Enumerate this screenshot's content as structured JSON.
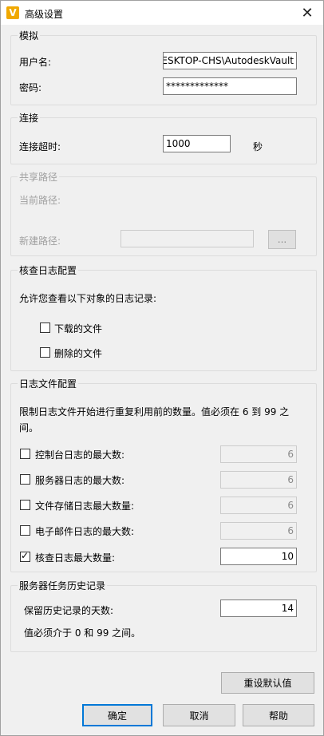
{
  "window": {
    "title": "高级设置",
    "app_icon_letter": "V",
    "close_glyph": "✕"
  },
  "simulation": {
    "legend": "模拟",
    "username_label": "用户名:",
    "username_value": "DESKTOP-CHS\\AutodeskVault",
    "password_label": "密码:",
    "password_value": "*************"
  },
  "connection": {
    "legend": "连接",
    "timeout_label": "连接超时:",
    "timeout_value": "1000",
    "unit": "秒"
  },
  "shared_path": {
    "legend": "共享路径",
    "current_label": "当前路径:",
    "new_label": "新建路径:",
    "new_value": "",
    "browse_label": "..."
  },
  "audit_log": {
    "legend": "核查日志配置",
    "description": "允许您查看以下对象的日志记录:",
    "items": [
      {
        "label": "下载的文件",
        "checked": false
      },
      {
        "label": "删除的文件",
        "checked": false
      }
    ]
  },
  "log_file": {
    "legend": "日志文件配置",
    "description": "限制日志文件开始进行重复利用前的数量。值必须在 6 到 99 之间。",
    "rows": [
      {
        "label": "控制台日志的最大数:",
        "checked": false,
        "value": "6"
      },
      {
        "label": "服务器日志的最大数:",
        "checked": false,
        "value": "6"
      },
      {
        "label": "文件存储日志最大数量:",
        "checked": false,
        "value": "6"
      },
      {
        "label": "电子邮件日志的最大数:",
        "checked": false,
        "value": "6"
      },
      {
        "label": "核查日志最大数量:",
        "checked": true,
        "value": "10"
      }
    ]
  },
  "task_history": {
    "legend": "服务器任务历史记录",
    "days_label": "保留历史记录的天数:",
    "days_value": "14",
    "note": "值必须介于 0 和 99 之间。"
  },
  "buttons": {
    "reset": "重设默认值",
    "ok": "确定",
    "cancel": "取消",
    "help": "帮助"
  }
}
